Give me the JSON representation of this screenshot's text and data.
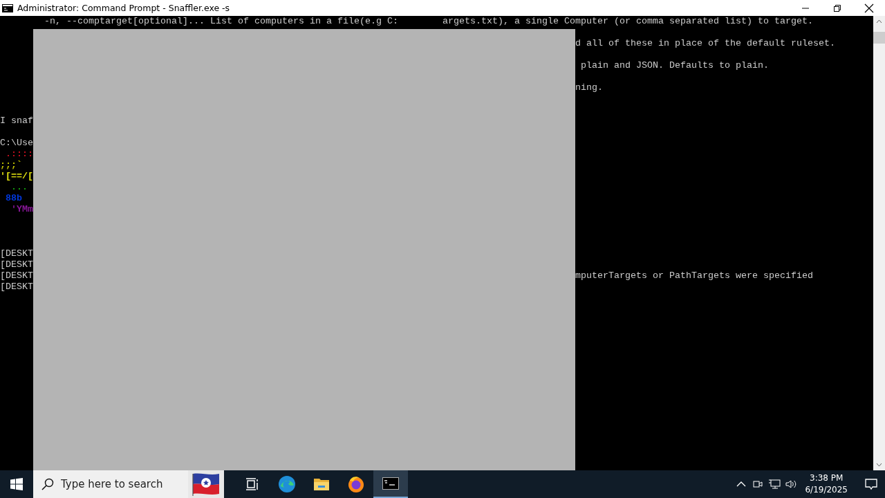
{
  "window": {
    "title": "Administrator: Command Prompt - Snaffler.exe  -s"
  },
  "console": {
    "lines": [
      {
        "kind": "indented",
        "left": "-n, --comptarget[optional]... List of computers in a file(e.g C:",
        "right": "argets.txt), a single Computer (or comma separated list) to target."
      },
      {
        "kind": "blank"
      },
      {
        "kind": "text",
        "right": "d all of these in place of the default ruleset."
      },
      {
        "kind": "blank"
      },
      {
        "kind": "text",
        "right": " plain and JSON. Defaults to plain."
      },
      {
        "kind": "blank"
      },
      {
        "kind": "text",
        "right": "ning."
      },
      {
        "kind": "blank"
      },
      {
        "kind": "blank"
      },
      {
        "kind": "text",
        "left": "I snaf"
      },
      {
        "kind": "blank"
      },
      {
        "kind": "text",
        "left": "C:\\Use"
      },
      {
        "kind": "text",
        "left": " .::::",
        "color": "#c50f1f"
      },
      {
        "kind": "text",
        "left": ";;;`",
        "color": "#c1c100"
      },
      {
        "kind": "text",
        "left": "'[==/[",
        "color": "#e5e510"
      },
      {
        "kind": "text",
        "left": "  ...",
        "color": "#13a10e"
      },
      {
        "kind": "text",
        "left": " 88b",
        "color": "#0037da"
      },
      {
        "kind": "text",
        "left": "  'YMm",
        "color": "#881798"
      },
      {
        "kind": "blank"
      },
      {
        "kind": "blank"
      },
      {
        "kind": "blank"
      },
      {
        "kind": "text",
        "left": "[DESKT"
      },
      {
        "kind": "text",
        "left": "[DESKT"
      },
      {
        "kind": "text",
        "left": "[DESKT",
        "right": "mputerTargets or PathTargets were specified"
      },
      {
        "kind": "text",
        "left": "[DESKT"
      }
    ]
  },
  "taskbar": {
    "search": {
      "placeholder": "Type here to search"
    },
    "apps": [
      {
        "kind": "taskview",
        "selected": false
      },
      {
        "kind": "edge",
        "selected": false
      },
      {
        "kind": "explorer",
        "selected": false
      },
      {
        "kind": "firefox",
        "selected": false
      },
      {
        "kind": "terminal",
        "selected": true
      }
    ],
    "time": "3:38 PM",
    "date": "6/19/2025"
  }
}
